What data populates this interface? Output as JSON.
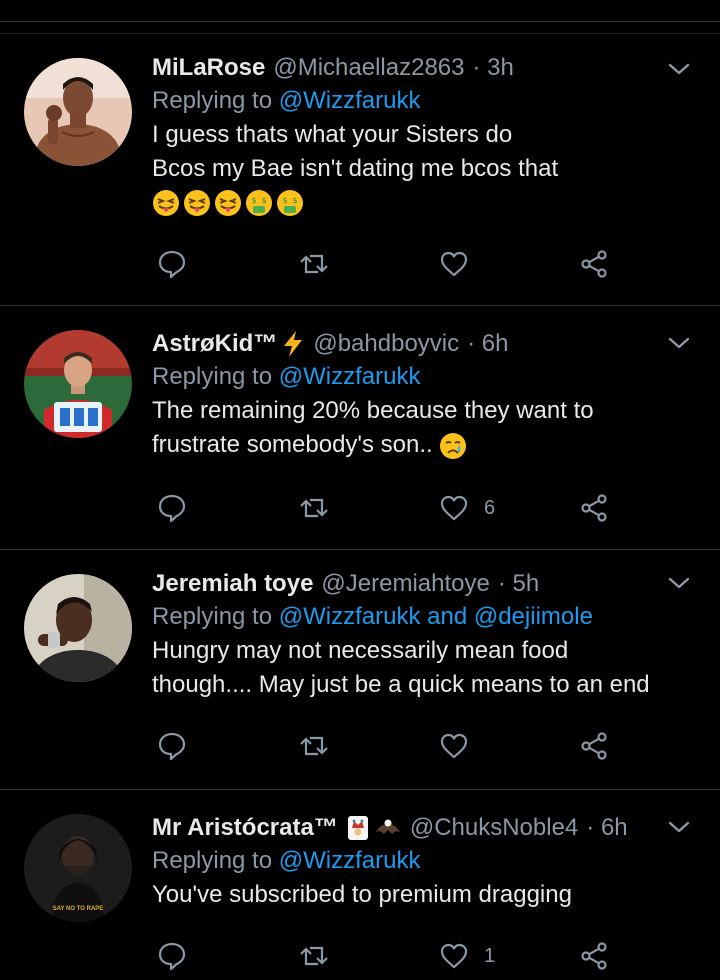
{
  "replying_label": "Replying to",
  "tweets": [
    {
      "name": "MiLaRose",
      "handle": "@Michaellaz2863",
      "time": "· 3h",
      "replying_to": "@Wizzfarukk",
      "text_lines": [
        "I guess thats what your Sisters do",
        "Bcos my Bae isn't dating me bcos that"
      ],
      "emojis": [
        "squinting-tongue",
        "squinting-tongue",
        "squinting-tongue",
        "money-mouth",
        "money-mouth"
      ],
      "likes": ""
    },
    {
      "name": "AstrøKid™",
      "name_emoji": "lightning-bolt",
      "handle": "@bahdboyvic",
      "time": "· 6h",
      "replying_to": "@Wizzfarukk",
      "text_lines": [
        "The remaining 20% because they want to",
        "frustrate somebody's son.."
      ],
      "text_emoji": "crying-face",
      "likes": "6"
    },
    {
      "name": "Jeremiah toye",
      "handle": "@Jeremiahtoye",
      "time": "· 5h",
      "replying_to": "@Wizzfarukk",
      "replying_and": "and",
      "replying_to_2": "@dejiimole",
      "text_lines": [
        "Hungry may not necessarily mean food",
        "though.... May just be a quick means to an end"
      ],
      "likes": ""
    },
    {
      "name": "Mr Aristócrata™",
      "name_emojis": [
        "joker-card",
        "eagle"
      ],
      "handle": "@ChuksNoble4",
      "time": "· 6h",
      "replying_to": "@Wizzfarukk",
      "text_lines": [
        "You've subscribed to premium dragging"
      ],
      "likes": "1",
      "avatar_caption": "SAY NO TO RAPE"
    }
  ],
  "colors": {
    "background": "#000000",
    "name": "#e7e9ea",
    "muted": "#8b98a5",
    "link": "#1d9bf0",
    "divider": "#2f3336"
  }
}
